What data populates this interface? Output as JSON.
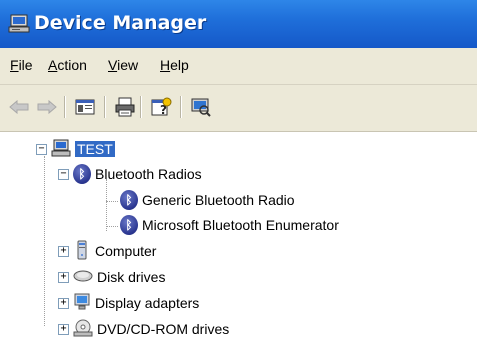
{
  "window": {
    "title": "Device Manager"
  },
  "menu": [
    {
      "accel": "F",
      "rest": "ile"
    },
    {
      "accel": "A",
      "rest": "ction"
    },
    {
      "accel": "V",
      "rest": "iew"
    },
    {
      "accel": "H",
      "rest": "elp"
    }
  ],
  "tree": {
    "root": "TEST",
    "bluetooth_radios": "Bluetooth Radios",
    "bt_generic": "Generic Bluetooth Radio",
    "bt_enumerator": "Microsoft Bluetooth Enumerator",
    "computer": "Computer",
    "disk_drives": "Disk drives",
    "display_adapters": "Display adapters",
    "dvd_drives": "DVD/CD-ROM drives"
  },
  "glyphs": {
    "bluetooth": "ᛒ",
    "collapse": "−",
    "expand": "+"
  }
}
